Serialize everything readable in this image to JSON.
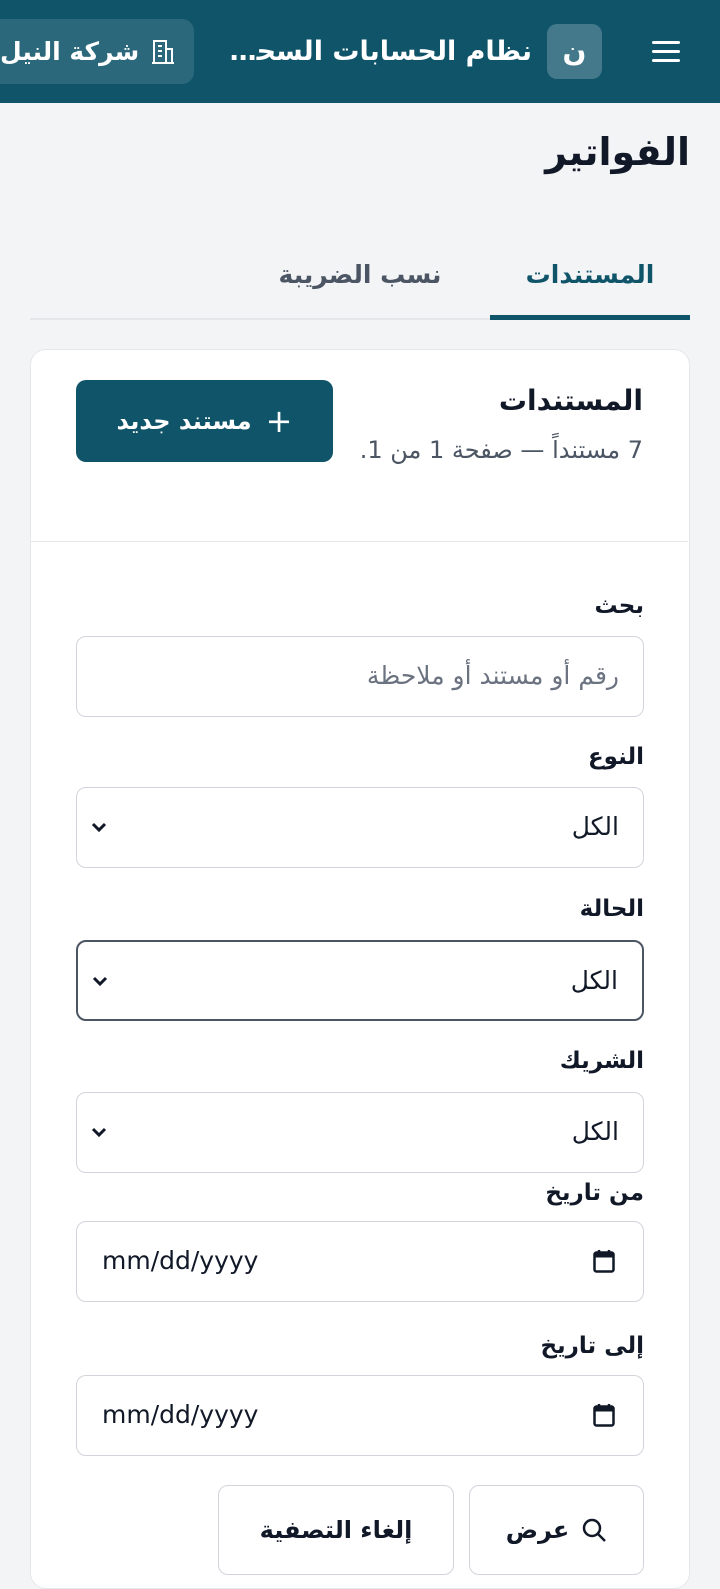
{
  "header": {
    "app_badge": "ن",
    "app_name": "نظام الحسابات السحابية",
    "company": "شركة النيل",
    "icons": {
      "menu": "hamburger-icon",
      "company": "building-icon"
    }
  },
  "page": {
    "title": "الفواتير"
  },
  "tabs": [
    {
      "label": "المستندات",
      "active": true
    },
    {
      "label": "نسب الضريبة",
      "active": false
    }
  ],
  "documents": {
    "title": "المستندات",
    "summary": "7 مستنداً — صفحة 1 من 1.",
    "new_button": "مستند جديد",
    "new_icon": "+"
  },
  "filters": {
    "search": {
      "label": "بحث",
      "placeholder": "رقم أو مستند أو ملاحظة",
      "value": ""
    },
    "type": {
      "label": "النوع",
      "selected": "الكل"
    },
    "status": {
      "label": "الحالة",
      "selected": "الكل"
    },
    "partner": {
      "label": "الشريك",
      "selected": "الكل"
    },
    "from_date": {
      "label": "من تاريخ",
      "value": "mm/dd/yyyy"
    },
    "to_date": {
      "label": "إلى تاريخ",
      "value": "mm/dd/yyyy"
    },
    "show_button": "عرض",
    "clear_button": "إلغاء التصفية"
  },
  "colors": {
    "primary": "#0f5469",
    "background": "#f3f4f6",
    "border": "#d1d5db"
  }
}
